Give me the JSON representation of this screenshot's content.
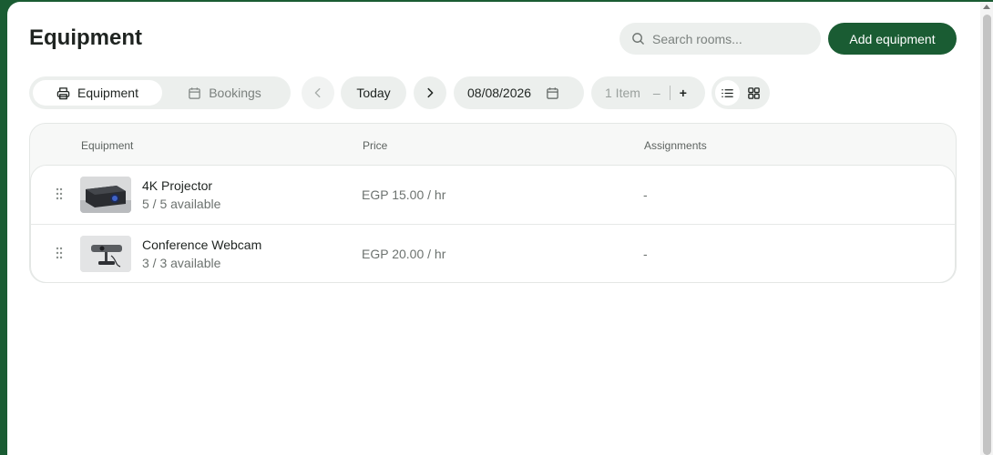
{
  "header": {
    "title": "Equipment",
    "search_placeholder": "Search rooms...",
    "add_button": "Add equipment"
  },
  "toolbar": {
    "tabs": [
      {
        "label": "Equipment",
        "icon": "printer-icon",
        "active": true
      },
      {
        "label": "Bookings",
        "icon": "calendar-icon",
        "active": false
      }
    ],
    "today_label": "Today",
    "date_value": "08/08/2026",
    "stepper": {
      "label": "1 Item",
      "minus": "–",
      "plus": "+"
    },
    "view_modes": [
      "list-view-icon",
      "grid-view-icon"
    ],
    "active_view": "list"
  },
  "table": {
    "columns": [
      "Equipment",
      "Price",
      "Assignments"
    ],
    "rows": [
      {
        "name": "4K Projector",
        "availability": "5 / 5 available",
        "price": "EGP 15.00 / hr",
        "assignments": "-",
        "thumb": "projector-image"
      },
      {
        "name": "Conference Webcam",
        "availability": "3 / 3 available",
        "price": "EGP 20.00 / hr",
        "assignments": "-",
        "thumb": "webcam-image"
      }
    ]
  },
  "colors": {
    "brand": "#1a5c33",
    "pill_bg": "#ecefed",
    "muted_text": "#6c726f"
  }
}
